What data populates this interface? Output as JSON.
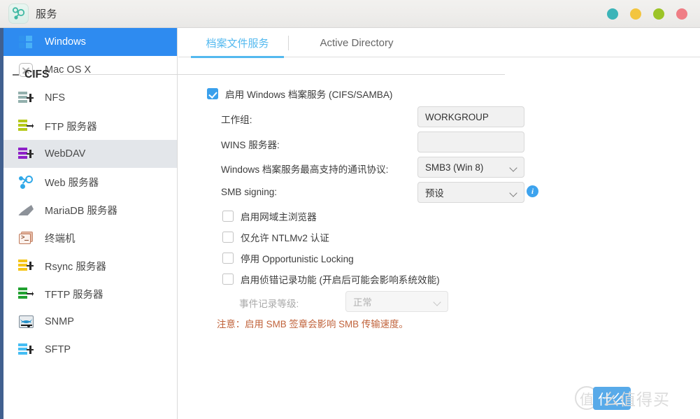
{
  "window": {
    "title": "服务",
    "app_icon": "services-node-icon",
    "buttons": [
      {
        "name": "teal-button",
        "color": "#3cb4b8"
      },
      {
        "name": "yellow-button",
        "color": "#f3c53f"
      },
      {
        "name": "green-button",
        "color": "#9cc427"
      },
      {
        "name": "red-button",
        "color": "#ef7d85"
      }
    ]
  },
  "sidebar": {
    "items": [
      {
        "label": "Windows",
        "icon": "windows-icon",
        "state": "selected"
      },
      {
        "label": "Mac OS X",
        "icon": "macosx-icon",
        "state": "normal"
      },
      {
        "label": "NFS",
        "icon": "nfs-server-icon",
        "state": "normal"
      },
      {
        "label": "FTP 服务器",
        "icon": "ftp-server-icon",
        "state": "normal"
      },
      {
        "label": "WebDAV",
        "icon": "webdav-icon",
        "state": "hovered"
      },
      {
        "label": "Web 服务器",
        "icon": "web-server-icon",
        "state": "normal"
      },
      {
        "label": "MariaDB 服务器",
        "icon": "mariadb-icon",
        "state": "normal"
      },
      {
        "label": "终端机",
        "icon": "terminal-icon",
        "state": "normal"
      },
      {
        "label": "Rsync 服务器",
        "icon": "rsync-server-icon",
        "state": "normal"
      },
      {
        "label": "TFTP 服务器",
        "icon": "tftp-server-icon",
        "state": "normal"
      },
      {
        "label": "SNMP",
        "icon": "snmp-icon",
        "state": "normal"
      },
      {
        "label": "SFTP",
        "icon": "sftp-icon",
        "state": "normal"
      }
    ]
  },
  "main": {
    "tabs": [
      {
        "label": "档案文件服务",
        "active": true
      },
      {
        "label": "Active Directory",
        "active": false
      }
    ],
    "section": {
      "legend": "CIFS",
      "collapse_icon": "minus-icon",
      "enable_checkbox": {
        "label": "启用 Windows 档案服务 (CIFS/SAMBA)",
        "checked": true
      },
      "fields": [
        {
          "label": "工作组:",
          "type": "text",
          "value": "WORKGROUP",
          "placeholder": ""
        },
        {
          "label": "WINS 服务器:",
          "type": "text",
          "value": "",
          "placeholder": ""
        },
        {
          "label": "Windows 档案服务最高支持的通讯协议:",
          "type": "select",
          "value": "SMB3 (Win 8)"
        },
        {
          "label": "SMB signing:",
          "type": "select",
          "value": "预设",
          "info_icon": "info-icon"
        }
      ],
      "options": [
        {
          "label": "启用网域主浏览器",
          "checked": false
        },
        {
          "label": "仅允许 NTLMv2 认证",
          "checked": false
        },
        {
          "label": "停用 Opportunistic Locking",
          "checked": false
        },
        {
          "label": "启用侦错记录功能 (开启后可能会影响系统效能)",
          "checked": false
        }
      ],
      "log_level": {
        "label": "事件记录等级:",
        "value": "正常",
        "disabled": true
      },
      "note": "注意：启用 SMB 签章会影响 SMB 传输速度。"
    }
  },
  "watermark": {
    "mark": "值",
    "highlight": "什么",
    "tail": "么值得买"
  }
}
